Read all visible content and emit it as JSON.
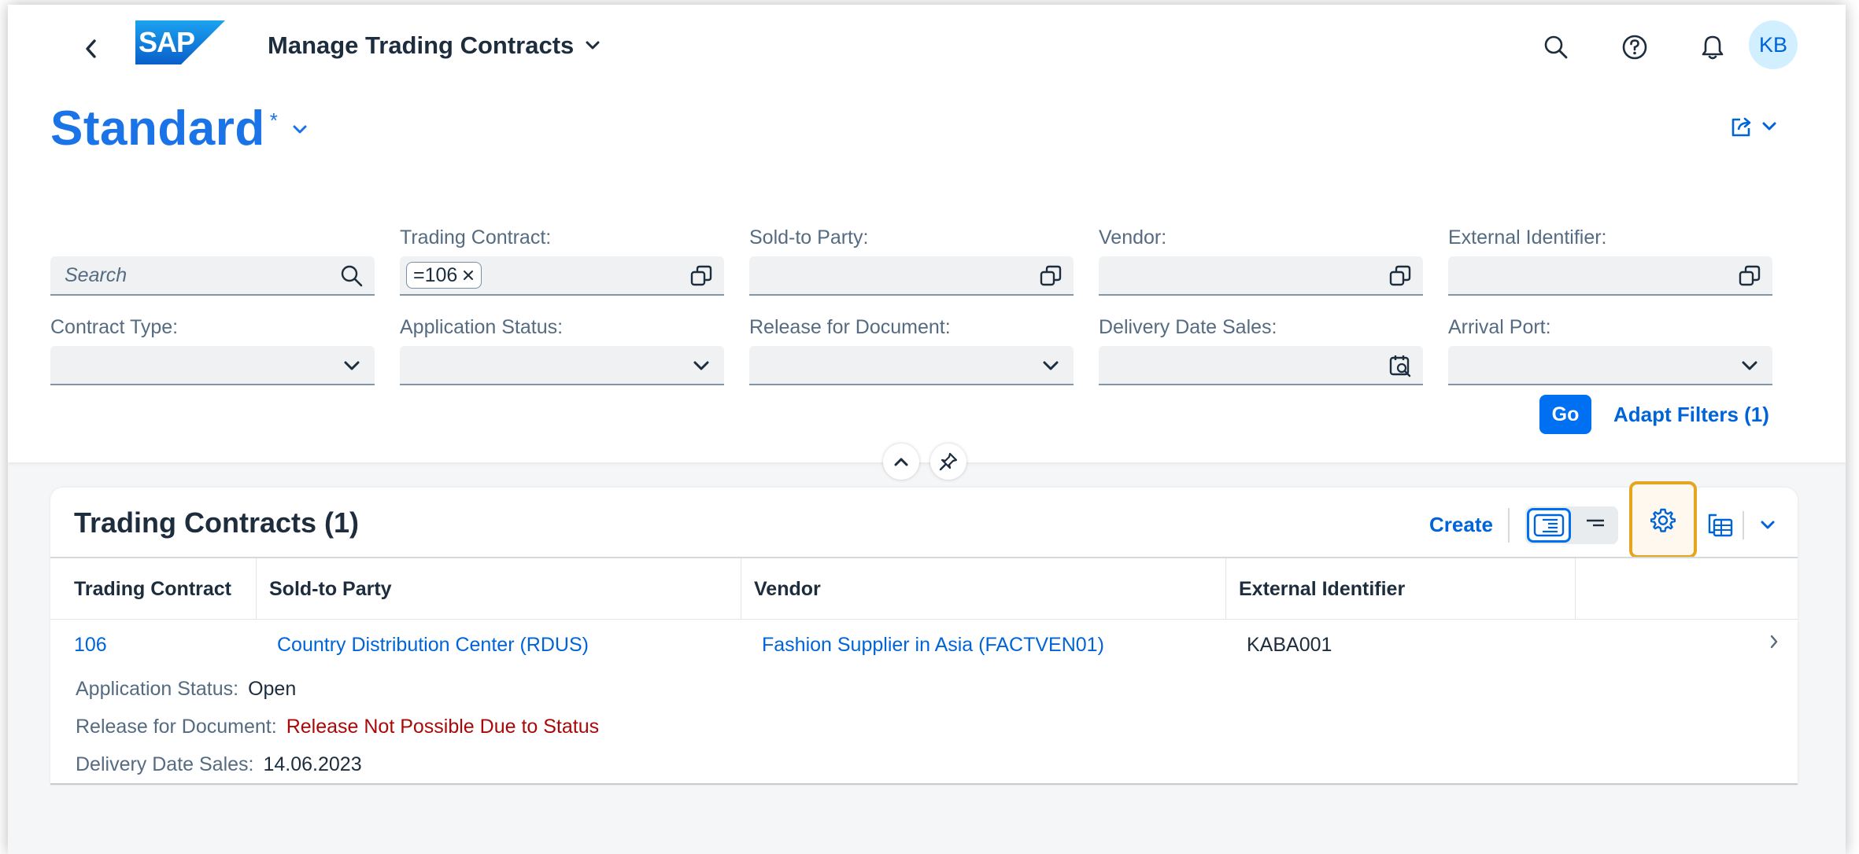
{
  "shell": {
    "logo_text": "SAP",
    "app_title": "Manage Trading Contracts",
    "avatar_initials": "KB"
  },
  "variant": {
    "title": "Standard",
    "modified_marker": "*"
  },
  "filters": {
    "search_placeholder": "Search",
    "trading_contract": {
      "label": "Trading Contract:",
      "token": "=106"
    },
    "sold_to_party": {
      "label": "Sold-to Party:"
    },
    "vendor": {
      "label": "Vendor:"
    },
    "external_identifier": {
      "label": "External Identifier:"
    },
    "contract_type": {
      "label": "Contract Type:"
    },
    "application_status": {
      "label": "Application Status:"
    },
    "release_for_document": {
      "label": "Release for Document:"
    },
    "delivery_date_sales": {
      "label": "Delivery Date Sales:"
    },
    "arrival_port": {
      "label": "Arrival Port:"
    },
    "go_label": "Go",
    "adapt_label": "Adapt Filters (1)"
  },
  "table": {
    "title": "Trading Contracts (1)",
    "create_label": "Create",
    "columns": [
      "Trading Contract",
      "Sold-to Party",
      "Vendor",
      "External Identifier"
    ],
    "rows": [
      {
        "trading_contract": "106",
        "sold_to_party": "Country Distribution Center (RDUS)",
        "vendor": "Fashion Supplier in Asia (FACTVEN01)",
        "external_identifier": "KABA001",
        "application_status_label": "Application Status:",
        "application_status": "Open",
        "release_label": "Release for Document:",
        "release": "Release Not Possible Due to Status",
        "delivery_label": "Delivery Date Sales:",
        "delivery_date": "14.06.2023"
      }
    ]
  },
  "colors": {
    "accent": "#0070f2",
    "link": "#0064d9",
    "variant_title": "#1b73e8",
    "highlight": "#e5a51f",
    "error_text": "#aa0808"
  },
  "icons": {
    "back": "chevron-left-icon",
    "search": "search-icon",
    "help": "help-icon",
    "notifications": "bell-icon",
    "share": "share-icon",
    "value_help": "value-help-icon",
    "dropdown": "chevron-down-icon",
    "calendar": "calendar-icon",
    "collapse": "chevron-up-icon",
    "pin": "pin-icon",
    "settings": "gear-icon",
    "export": "export-icon"
  }
}
